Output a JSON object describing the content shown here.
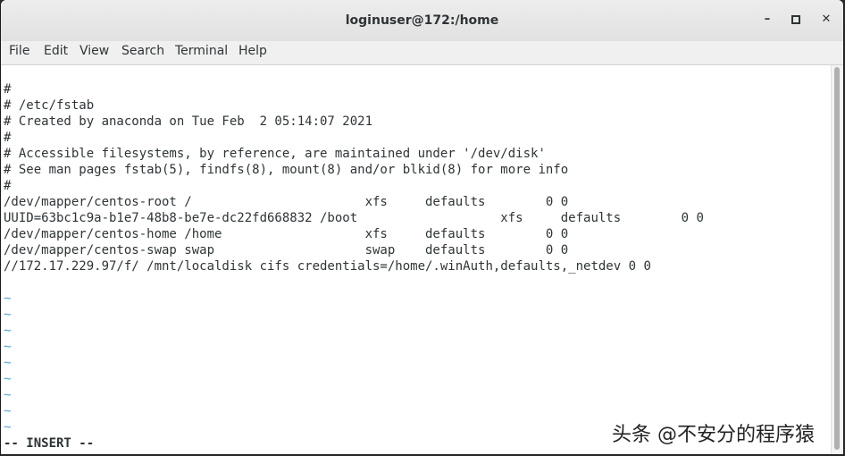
{
  "window": {
    "title": "loginuser@172:/home"
  },
  "controls": {
    "minimize": "–",
    "maximize": "▫",
    "close": "✕"
  },
  "menu": [
    "File",
    "Edit",
    "View",
    "Search",
    "Terminal",
    "Help"
  ],
  "terminal": {
    "lines": [
      "#",
      "# /etc/fstab",
      "# Created by anaconda on Tue Feb  2 05:14:07 2021",
      "#",
      "# Accessible filesystems, by reference, are maintained under '/dev/disk'",
      "# See man pages fstab(5), findfs(8), mount(8) and/or blkid(8) for more info",
      "#",
      "/dev/mapper/centos-root /                       xfs     defaults        0 0",
      "UUID=63bc1c9a-b1e7-48b8-be7e-dc22fd668832 /boot                   xfs     defaults        0 0",
      "/dev/mapper/centos-home /home                   xfs     defaults        0 0",
      "/dev/mapper/centos-swap swap                    swap    defaults        0 0",
      "//172.17.229.97/f/ /mnt/localdisk cifs credentials=/home/.winAuth,defaults,_netdev 0 0",
      ""
    ],
    "tilde": "~",
    "mode": "-- INSERT --"
  },
  "watermark": "头条 @不安分的程序猿"
}
